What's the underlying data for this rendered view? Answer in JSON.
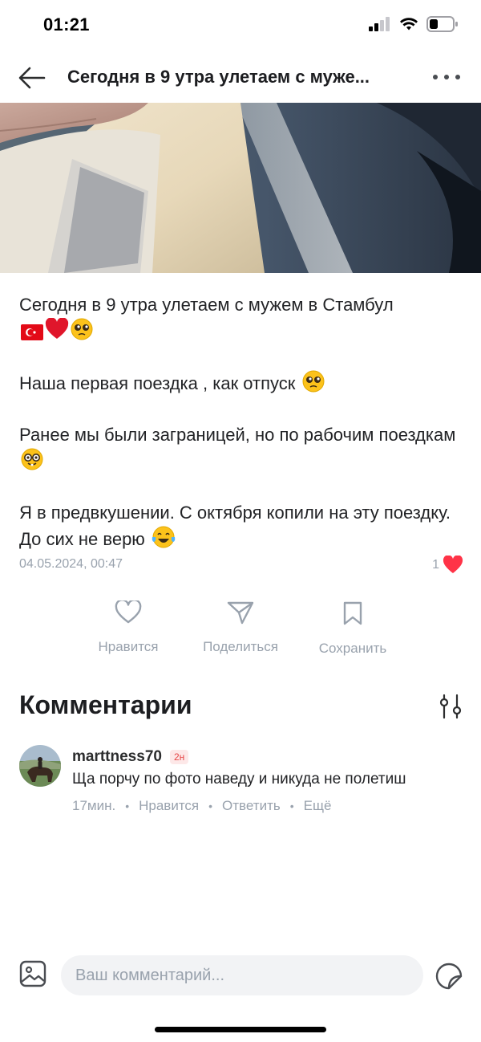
{
  "status": {
    "time": "01:21"
  },
  "nav": {
    "title": "Сегодня в 9 утра улетаем с муже..."
  },
  "post": {
    "lines": {
      "p1": "Сегодня в 9 утра улетаем с мужем в Стамбул",
      "p2": "Наша первая поездка , как отпуск",
      "p3": "Ранее мы были заграницей, но по рабочим поездкам",
      "p4": "Я в предвкушении. С октября копили на эту поездку. До сих не верю"
    },
    "emojis": [
      "flag-turkey",
      "red-heart",
      "pleading-face",
      "pleading-face",
      "nerd-face",
      "tears-of-joy-face"
    ],
    "date": "04.05.2024, 00:47",
    "likes_count": "1"
  },
  "actions": {
    "like": "Нравится",
    "share": "Поделиться",
    "save": "Сохранить"
  },
  "comments": {
    "title": "Комментарии",
    "items": [
      {
        "author": "marttness70",
        "badge": "2н",
        "text": "Ща порчу по фото наведу и никуда не полетиш",
        "time": "17мин.",
        "like": "Нравится",
        "reply": "Ответить",
        "more": "Ещё"
      }
    ]
  },
  "composer": {
    "placeholder": "Ваш комментарий..."
  },
  "colors": {
    "accent_heart": "#ff3347",
    "muted_text": "#99a2ad",
    "text": "#222326"
  }
}
